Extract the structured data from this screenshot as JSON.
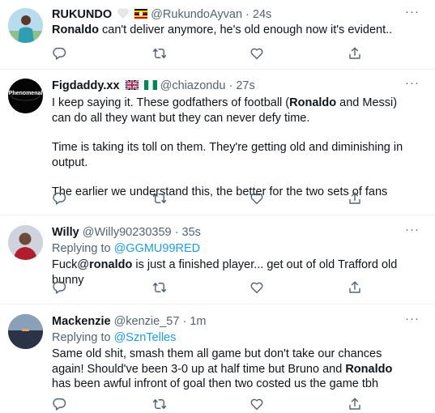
{
  "tweets": [
    {
      "name": "RUKUNDO",
      "handle": "@RukundoAyvan",
      "sep": "·",
      "time": "24s",
      "replying_label": "",
      "replying_handle": "",
      "text_parts": [
        {
          "t": "Ronaldo",
          "bold": true
        },
        {
          "t": " can't deliver anymore, he's old enough now it's evident..",
          "bold": false
        }
      ]
    },
    {
      "name": "Figdaddy.xx",
      "handle": "@chiazondu",
      "sep": "·",
      "time": "27s",
      "avatar_text": "Phenomenal",
      "para1_a": "I keep saying it. These godfathers of football (",
      "para1_b": "Ronaldo",
      "para1_c": " and Messi) can do all they want but they can never defy time.",
      "para2": "Time is taking its toll on them. They're getting old and diminishing in output.",
      "para3": "The earlier we understand this, the better for the two sets of fans"
    },
    {
      "name": "Willy",
      "handle": "@Willy90230359",
      "sep": "·",
      "time": "35s",
      "replying_label": "Replying to ",
      "replying_handle": "@GGMU99RED",
      "text_a": "Fuck@",
      "text_b": "ronaldo",
      "text_c": " is just a finished player... get out of old Trafford old bunny"
    },
    {
      "name": "Mackenzie",
      "handle": "@kenzie_57",
      "sep": "·",
      "time": "1m",
      "replying_label": "Replying to ",
      "replying_handle": "@SznTelles",
      "text_a": "Same old shit, smash them all game but don't take our chances again! Should've been 3-0 up at half time but Bruno and ",
      "text_b": "Ronaldo",
      "text_c": " has been awful infront of goal then two costed us the game tbh"
    }
  ],
  "icons": {
    "reply": "reply-icon",
    "retweet": "retweet-icon",
    "like": "heart-icon",
    "share": "share-icon",
    "more": "more-icon"
  },
  "colors": {
    "text": "#0f1419",
    "muted": "#536471",
    "link": "#1d9bf0",
    "divider": "#eff3f4"
  }
}
